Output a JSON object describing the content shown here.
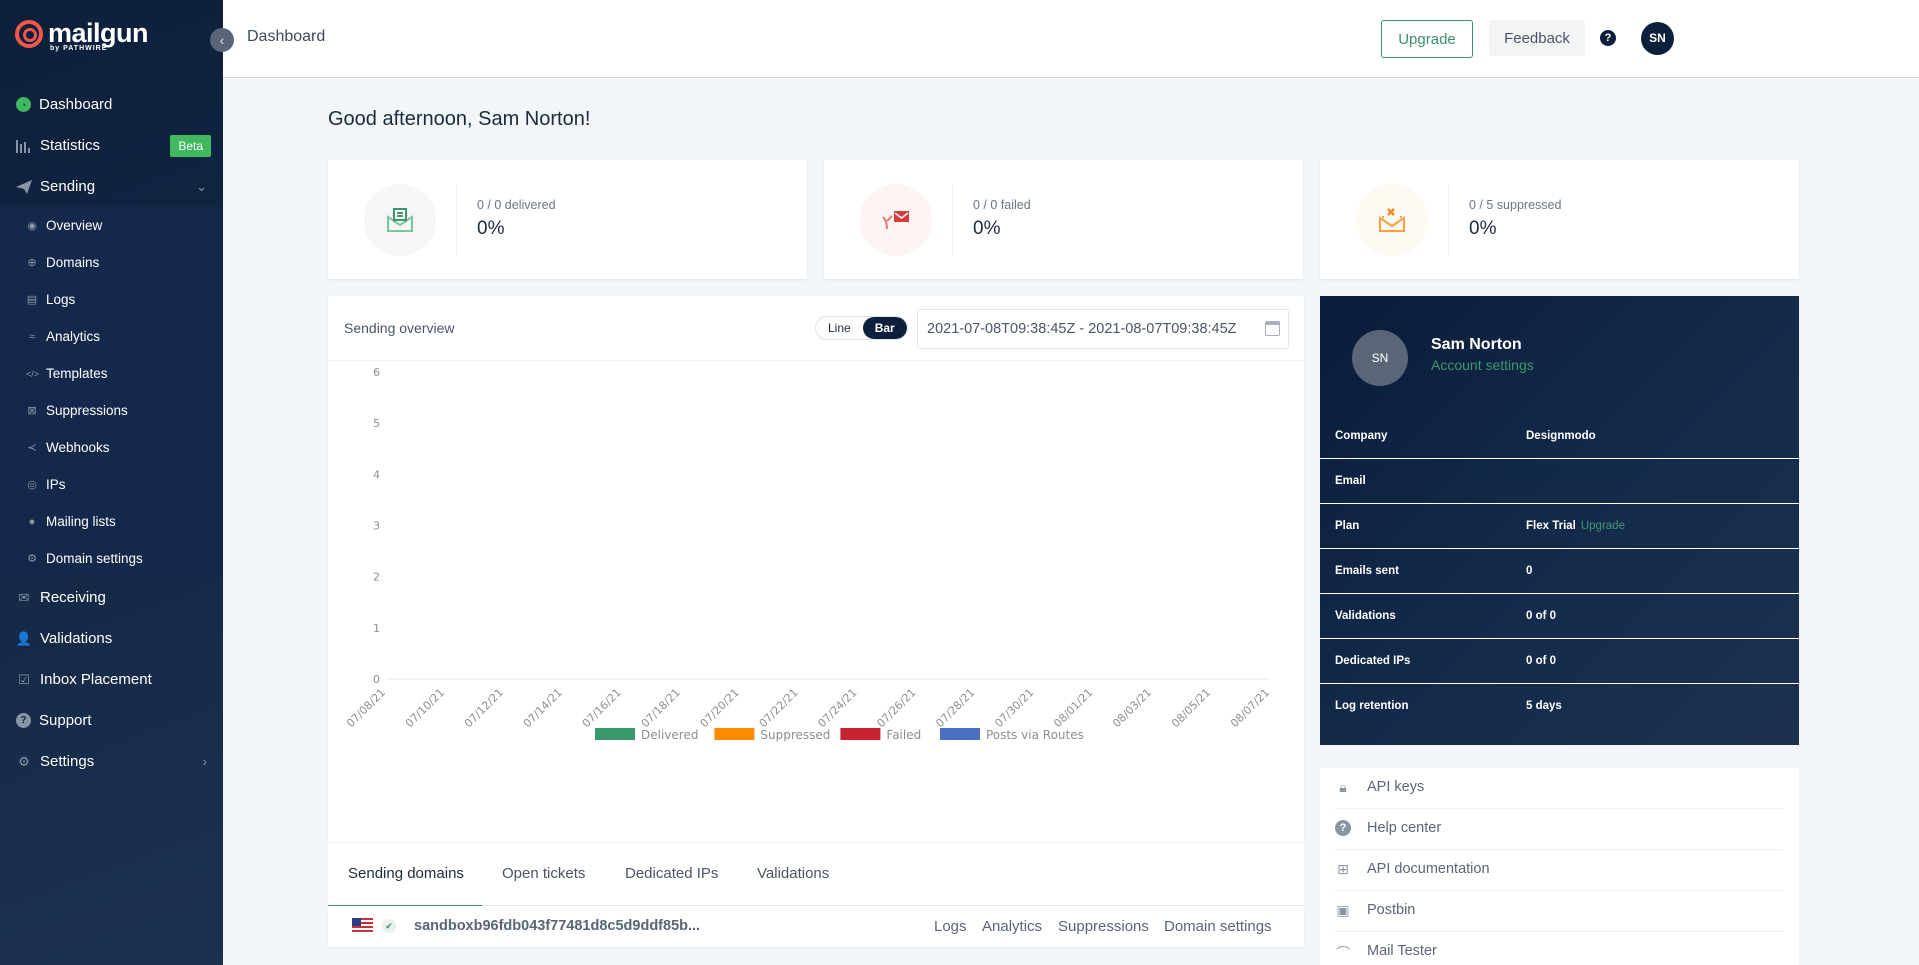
{
  "brand": {
    "name": "mailgun",
    "sub": "by PATHWIRE",
    "accent": "#f0584b"
  },
  "sidebar": {
    "collapse_icon": "‹",
    "items": [
      {
        "label": "Dashboard",
        "icon": "dashboard-icon"
      },
      {
        "label": "Statistics",
        "icon": "bar-chart-icon",
        "badge": "Beta"
      },
      {
        "label": "Sending",
        "icon": "paper-plane-icon",
        "expanded": true
      }
    ],
    "sending_sub": [
      {
        "label": "Overview",
        "icon": "eye-icon"
      },
      {
        "label": "Domains",
        "icon": "globe-icon"
      },
      {
        "label": "Logs",
        "icon": "log-icon"
      },
      {
        "label": "Analytics",
        "icon": "analytics-icon"
      },
      {
        "label": "Templates",
        "icon": "code-icon"
      },
      {
        "label": "Suppressions",
        "icon": "suppression-icon"
      },
      {
        "label": "Webhooks",
        "icon": "share-icon"
      },
      {
        "label": "IPs",
        "icon": "pin-icon"
      },
      {
        "label": "Mailing lists",
        "icon": "user-icon"
      },
      {
        "label": "Domain settings",
        "icon": "gear-icon"
      }
    ],
    "bottom": [
      {
        "label": "Receiving",
        "icon": "inbox-icon"
      },
      {
        "label": "Validations",
        "icon": "user-check-icon"
      },
      {
        "label": "Inbox Placement",
        "icon": "checkbox-icon"
      },
      {
        "label": "Support",
        "icon": "question-icon"
      },
      {
        "label": "Settings",
        "icon": "gear-icon"
      }
    ]
  },
  "topbar": {
    "title": "Dashboard",
    "upgrade": "Upgrade",
    "feedback": "Feedback",
    "help": "?",
    "avatar": "SN"
  },
  "greeting": "Good afternoon, Sam Norton!",
  "stats": [
    {
      "label": "0 / 0 delivered",
      "value": "0%",
      "color": "#3b9a6d",
      "bg": "#f4f7f5"
    },
    {
      "label": "0 / 0 failed",
      "value": "0%",
      "color": "#d63a3a",
      "bg": "#fdf4f4"
    },
    {
      "label": "0 / 5 suppressed",
      "value": "0%",
      "color": "#f5a142",
      "bg": "#fef9f3"
    }
  ],
  "overview": {
    "title": "Sending overview",
    "toggle": {
      "line": "Line",
      "bar": "Bar",
      "selected": "Bar"
    },
    "date_range": "2021-07-08T09:38:45Z - 2021-08-07T09:38:45Z"
  },
  "chart_data": {
    "type": "bar",
    "title": "Sending overview",
    "xlabel": "",
    "ylabel": "",
    "ylim": [
      0,
      6
    ],
    "yticks": [
      0,
      1,
      2,
      3,
      4,
      5,
      6
    ],
    "categories": [
      "07/08/21",
      "07/10/21",
      "07/12/21",
      "07/14/21",
      "07/16/21",
      "07/18/21",
      "07/20/21",
      "07/22/21",
      "07/24/21",
      "07/26/21",
      "07/28/21",
      "07/30/21",
      "08/01/21",
      "08/03/21",
      "08/05/21",
      "08/07/21"
    ],
    "series": [
      {
        "name": "Delivered",
        "color": "#3b9a6d",
        "values": [
          0,
          0,
          0,
          0,
          0,
          0,
          0,
          0,
          0,
          0,
          0,
          0,
          0,
          0,
          0,
          0
        ]
      },
      {
        "name": "Suppressed",
        "color": "#ff8c00",
        "values": [
          0,
          0,
          0,
          0,
          0,
          0,
          0,
          0,
          0,
          0,
          0,
          0,
          0,
          0,
          0,
          0
        ]
      },
      {
        "name": "Failed",
        "color": "#c62430",
        "values": [
          0,
          0,
          0,
          0,
          0,
          0,
          0,
          0,
          0,
          0,
          0,
          0,
          0,
          0,
          0,
          0
        ]
      },
      {
        "name": "Posts via Routes",
        "color": "#4a6fc0",
        "values": [
          0,
          0,
          0,
          0,
          0,
          0,
          0,
          0,
          0,
          0,
          0,
          0,
          0,
          0,
          0,
          0
        ]
      }
    ],
    "legend": "bottom",
    "grid": false
  },
  "tabs": [
    "Sending domains",
    "Open tickets",
    "Dedicated IPs",
    "Validations"
  ],
  "domain": {
    "name": "sandboxb96fdb043f77481d8c5d9ddf85b...",
    "links": [
      "Logs",
      "Analytics",
      "Suppressions",
      "Domain settings"
    ]
  },
  "account": {
    "avatar": "SN",
    "name": "Sam Norton",
    "settings_link": "Account settings",
    "rows": [
      {
        "key": "Company",
        "value": "Designmodo"
      },
      {
        "key": "Email",
        "value": ""
      },
      {
        "key": "Plan",
        "value": "Flex Trial",
        "action": "Upgrade"
      },
      {
        "key": "Emails sent",
        "value": "0"
      },
      {
        "key": "Validations",
        "value": "0 of 0"
      },
      {
        "key": "Dedicated IPs",
        "value": "0 of 0"
      },
      {
        "key": "Log retention",
        "value": "5 days"
      }
    ]
  },
  "quick_links": [
    {
      "label": "API keys",
      "icon": "lock-icon"
    },
    {
      "label": "Help center",
      "icon": "help-icon"
    },
    {
      "label": "API documentation",
      "icon": "apps-icon"
    },
    {
      "label": "Postbin",
      "icon": "inbox-icon"
    },
    {
      "label": "Mail Tester",
      "icon": "antenna-icon"
    }
  ]
}
